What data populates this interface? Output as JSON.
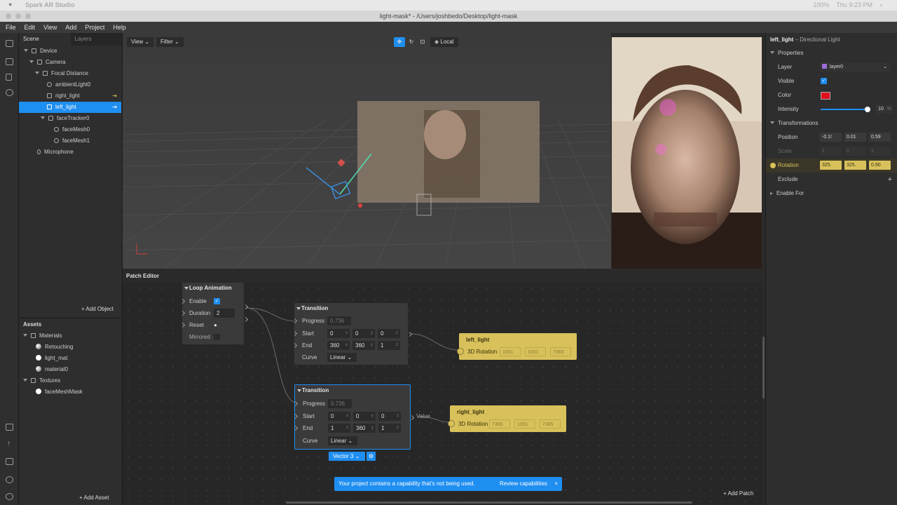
{
  "system": {
    "app_name": "Spark AR Studio",
    "battery": "100%",
    "clock": "Thu 9:23 PM"
  },
  "window": {
    "title": "light-mask* - /Users/joshbedo/Desktop/light-mask"
  },
  "menu": [
    "File",
    "Edit",
    "View",
    "Add",
    "Project",
    "Help"
  ],
  "scene_panel": {
    "tabs": [
      "Scene",
      "Layers"
    ],
    "items": [
      {
        "label": "Device"
      },
      {
        "label": "Camera"
      },
      {
        "label": "Focal Distance"
      },
      {
        "label": "ambientLight0"
      },
      {
        "label": "right_light"
      },
      {
        "label": "left_light"
      },
      {
        "label": "faceTracker0"
      },
      {
        "label": "faceMesh0"
      },
      {
        "label": "faceMesh1"
      },
      {
        "label": "Microphone"
      }
    ],
    "add_object": "+ Add Object"
  },
  "assets_panel": {
    "title": "Assets",
    "items": [
      {
        "label": "Materials"
      },
      {
        "label": "Retouching"
      },
      {
        "label": "light_mat"
      },
      {
        "label": "material0"
      },
      {
        "label": "Textures"
      },
      {
        "label": "faceMeshMask"
      }
    ],
    "add_asset": "+ Add Asset"
  },
  "viewport": {
    "view_label": "View",
    "filter_label": "Filter",
    "local_label": "Local"
  },
  "patch_editor": {
    "title": "Patch Editor",
    "add_patch": "+ Add Patch",
    "loop_animation": {
      "title": "Loop Animation",
      "enable": "Enable",
      "duration": "Duration",
      "duration_value": "2",
      "reset": "Reset",
      "mirrored": "Mirrored"
    },
    "transition1": {
      "title": "Transition",
      "progress": "Progress",
      "progress_value": "0.736",
      "start": "Start",
      "start_values": [
        "0",
        "0",
        "0"
      ],
      "end": "End",
      "end_values": [
        "360",
        "360",
        "1"
      ],
      "curve": "Curve",
      "curve_value": "Linear"
    },
    "transition2": {
      "title": "Transition",
      "progress": "Progress",
      "progress_value": "0.736",
      "start": "Start",
      "start_values": [
        "0",
        "0",
        "0"
      ],
      "end": "End",
      "end_values": [
        "1",
        "360",
        "1"
      ],
      "curve": "Curve",
      "curve_value": "Linear",
      "output": "Value",
      "type": "Vector 3"
    },
    "left_light_node": {
      "title": "left_light",
      "prop": "3D Rotation",
      "values": [
        "1001",
        "1001",
        "7365"
      ]
    },
    "right_light_node": {
      "title": "right_light",
      "prop": "3D Rotation",
      "values": [
        "7365",
        "1001",
        "7365"
      ]
    },
    "axis_labels": [
      "x",
      "y",
      "z"
    ]
  },
  "toast": {
    "message": "Your project contains a capability that's not being used.",
    "action": "Review capabilities"
  },
  "inspector": {
    "title": "left_light",
    "subtitle": "– Directional Light",
    "properties": "Properties",
    "layer_label": "Layer",
    "layer_value": "layer0",
    "visible_label": "Visible",
    "color_label": "Color",
    "color_value": "#e0101e",
    "intensity_label": "Intensity",
    "intensity_value": "10",
    "intensity_unit": "%",
    "intensity_level": 0.95,
    "transformations": "Transformations",
    "position_label": "Position",
    "position_values": [
      "-0.1!",
      "0.01",
      "0.59"
    ],
    "scale_label": "Scale",
    "scale_values": [
      "1",
      "1",
      "1"
    ],
    "rotation_label": "Rotation",
    "rotation_values": [
      "325.",
      "325.",
      "0.90"
    ],
    "exclude_label": "Exclude",
    "enable_for_label": "Enable For"
  },
  "colors": {
    "accent": "#1f8ef1",
    "patch_yellow": "#d8c15a"
  }
}
